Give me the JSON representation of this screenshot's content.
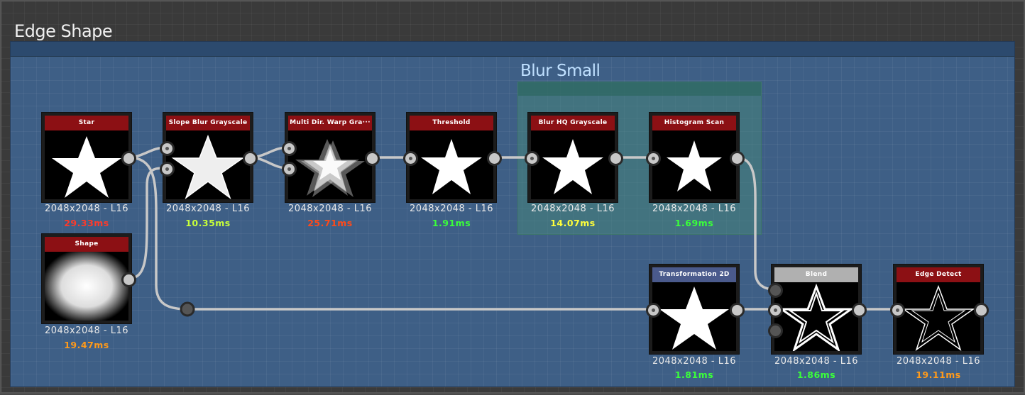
{
  "frame": {
    "title": "Edge Shape"
  },
  "subframe": {
    "title": "Blur Small"
  },
  "colors": {
    "frame_bg": "#3e5f86",
    "node_title_red": "#8c1014",
    "node_title_blue": "#4a5a8c",
    "node_title_grey": "#b0b0b0",
    "time_red": "#ff3a2a",
    "time_orange": "#ff9a1a",
    "time_yellow": "#ffff3a",
    "time_yellowgreen": "#c8ff3a",
    "time_green": "#3aff3a"
  },
  "nodes": {
    "star": {
      "title": "Star",
      "resolution": "2048x2048 - L16",
      "time": "29.33ms",
      "time_color": "#ff3a2a"
    },
    "shape": {
      "title": "Shape",
      "resolution": "2048x2048 - L16",
      "time": "19.47ms",
      "time_color": "#ff9a1a"
    },
    "slope_blur": {
      "title": "Slope Blur Grayscale",
      "resolution": "2048x2048 - L16",
      "time": "10.35ms",
      "time_color": "#c8ff3a"
    },
    "multi_warp": {
      "title": "Multi Dir. Warp Gra···",
      "resolution": "2048x2048 - L16",
      "time": "25.71ms",
      "time_color": "#ff4a1a"
    },
    "threshold": {
      "title": "Threshold",
      "resolution": "2048x2048 - L16",
      "time": "1.91ms",
      "time_color": "#3aff3a"
    },
    "blur_hq": {
      "title": "Blur HQ Grayscale",
      "resolution": "2048x2048 - L16",
      "time": "14.07ms",
      "time_color": "#ffff3a"
    },
    "histogram": {
      "title": "Histogram Scan",
      "resolution": "2048x2048 - L16",
      "time": "1.69ms",
      "time_color": "#3aff3a"
    },
    "transform": {
      "title": "Transformation 2D",
      "resolution": "2048x2048 - L16",
      "time": "1.81ms",
      "time_color": "#3aff3a"
    },
    "blend": {
      "title": "Blend",
      "resolution": "2048x2048 - L16",
      "time": "1.86ms",
      "time_color": "#3aff3a"
    },
    "edge_detect": {
      "title": "Edge Detect",
      "resolution": "2048x2048 - L16",
      "time": "19.11ms",
      "time_color": "#ff9a1a"
    }
  }
}
